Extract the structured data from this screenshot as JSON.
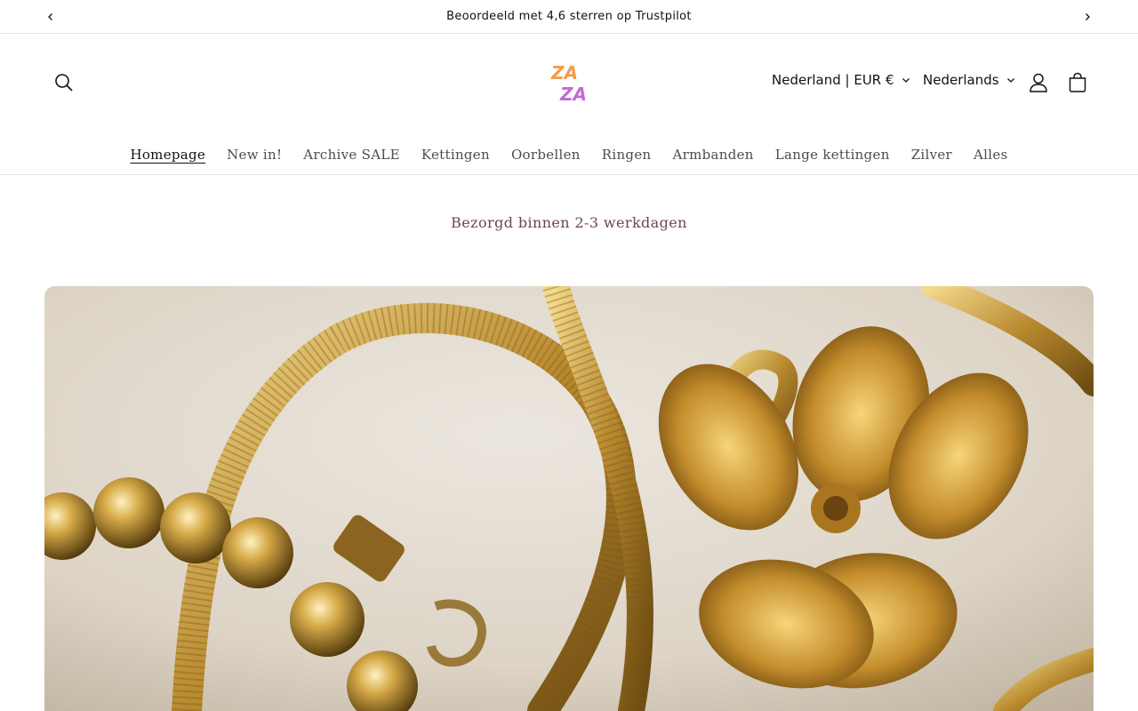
{
  "announcement": {
    "text": "Beoordeeld met 4,6 sterren op Trustpilot",
    "prev_icon": "chevron-left-icon",
    "next_icon": "chevron-right-icon"
  },
  "header": {
    "logo_text_top": "ZA",
    "logo_text_bottom": "ZA",
    "country_selector": "Nederland | EUR €",
    "language_selector": "Nederlands",
    "icons": [
      "search-icon",
      "account-icon",
      "cart-icon",
      "chevron-down-icon"
    ]
  },
  "nav": {
    "items": [
      {
        "label": "Homepage",
        "active": true
      },
      {
        "label": "New in!"
      },
      {
        "label": "Archive SALE"
      },
      {
        "label": "Kettingen"
      },
      {
        "label": "Oorbellen"
      },
      {
        "label": "Ringen"
      },
      {
        "label": "Armbanden"
      },
      {
        "label": "Lange kettingen"
      },
      {
        "label": "Zilver"
      },
      {
        "label": "Alles"
      }
    ]
  },
  "delivery_text": "Bezorgd binnen 2-3 werkdagen",
  "colors": {
    "logo_orange": "#f59a4a",
    "logo_purple": "#c46ad6",
    "delivery_text": "#6b4552",
    "gold": "#c9a24a"
  }
}
